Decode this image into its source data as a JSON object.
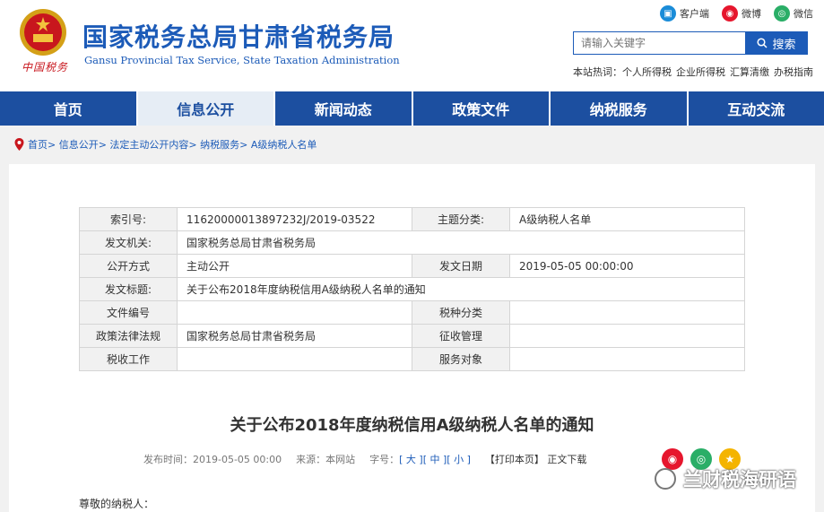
{
  "header": {
    "seal_text": "中国税务",
    "title": "国家税务总局甘肃省税务局",
    "subtitle": "Gansu Provincial Tax Service, State Taxation Administration",
    "top_links": [
      "客户端",
      "微博",
      "微信"
    ],
    "search_placeholder": "请输入关键字",
    "search_button": "搜索",
    "hot_label": "本站热词：",
    "hot_words": [
      "个人所得税",
      "企业所得税",
      "汇算清缴",
      "办税指南"
    ]
  },
  "nav": [
    "首页",
    "信息公开",
    "新闻动态",
    "政策文件",
    "纳税服务",
    "互动交流"
  ],
  "breadcrumb": "首页> 信息公开> 法定主动公开内容> 纳税服务> A级纳税人名单",
  "meta": {
    "r0": [
      "索引号:",
      "11620000013897232J/2019-03522",
      "主题分类:",
      "A级纳税人名单"
    ],
    "r1": [
      "发文机关:",
      "国家税务总局甘肃省税务局"
    ],
    "r2": [
      "公开方式",
      "主动公开",
      "发文日期",
      "2019-05-05 00:00:00"
    ],
    "r3": [
      "发文标题:",
      "关于公布2018年度纳税信用A级纳税人名单的通知"
    ],
    "r4": [
      "文件编号",
      "",
      "税种分类",
      ""
    ],
    "r5": [
      "政策法律法规",
      "国家税务总局甘肃省税务局",
      "征收管理",
      ""
    ],
    "r6": [
      "税收工作",
      "",
      "服务对象",
      ""
    ]
  },
  "article": {
    "title": "关于公布2018年度纳税信用A级纳税人名单的通知",
    "publish": "发布时间：2019-05-05 00:00",
    "source": "来源：本网站",
    "font_label": "字号：",
    "font_sizes": [
      "[ 大 ]",
      "[ 中 ]",
      "[ 小 ]"
    ],
    "print": "【打印本页】",
    "download": "正文下载",
    "greeting": "尊敬的纳税人："
  },
  "watermark": "兰财税海研语",
  "colors": {
    "brand_blue": "#1c5bb8",
    "nav_blue": "#1c4fa0"
  }
}
